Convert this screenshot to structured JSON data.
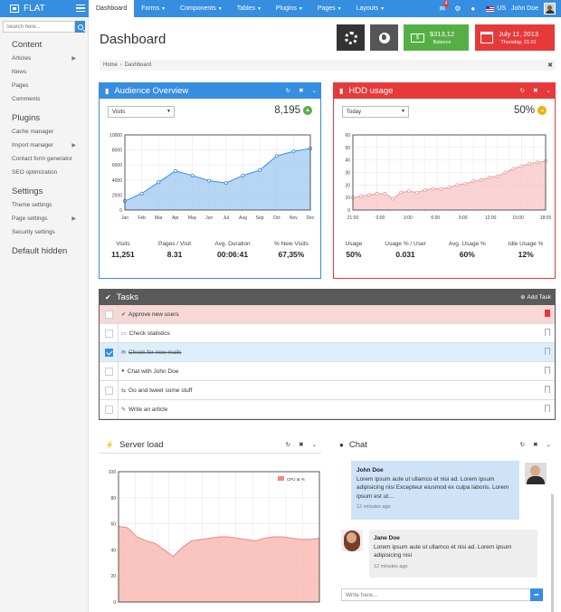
{
  "brand": {
    "name": "FLAT"
  },
  "nav": [
    {
      "label": "Dashboard",
      "caret": false,
      "active": true
    },
    {
      "label": "Forms",
      "caret": true
    },
    {
      "label": "Components",
      "caret": true
    },
    {
      "label": "Tables",
      "caret": true
    },
    {
      "label": "Plugins",
      "caret": true
    },
    {
      "label": "Pages",
      "caret": true
    },
    {
      "label": "Layouts",
      "caret": true
    }
  ],
  "topbar": {
    "mail_badge": "4",
    "lang": "US",
    "user_name": "John Doe"
  },
  "sidebar": {
    "search_placeholder": "Search here...",
    "sections": [
      {
        "title": "Content",
        "items": [
          {
            "label": "Articles",
            "arrow": true
          },
          {
            "label": "News"
          },
          {
            "label": "Pages"
          },
          {
            "label": "Comments"
          }
        ]
      },
      {
        "title": "Plugins",
        "items": [
          {
            "label": "Cache manager"
          },
          {
            "label": "Import manager",
            "arrow": true
          },
          {
            "label": "Contact form generator"
          },
          {
            "label": "SEO optimization"
          }
        ]
      },
      {
        "title": "Settings",
        "items": [
          {
            "label": "Theme settings"
          },
          {
            "label": "Page settings",
            "arrow": true
          },
          {
            "label": "Security settings"
          }
        ]
      },
      {
        "title": "Default hidden",
        "items": []
      }
    ]
  },
  "page": {
    "title": "Dashboard"
  },
  "tiles": {
    "balance_value": "$313,12",
    "balance_label": "Balance",
    "date": "July 11, 2013",
    "datetime": "Thursday, 21:01"
  },
  "breadcrumb": [
    "Home",
    "Dashboard"
  ],
  "audience": {
    "title": "Audience Overview",
    "select_value": "Visits",
    "big_value": "8,195",
    "stats": [
      {
        "label": "Visits",
        "value": "11,251"
      },
      {
        "label": "Pages / Visit",
        "value": "8.31"
      },
      {
        "label": "Avg. Duration",
        "value": "00:06:41"
      },
      {
        "label": "% New Visits",
        "value": "67,35%"
      }
    ]
  },
  "hdd": {
    "title": "HDD usage",
    "select_value": "Today",
    "big_value": "50%",
    "stats": [
      {
        "label": "Usage",
        "value": "50%"
      },
      {
        "label": "Usage % / User",
        "value": "0.031"
      },
      {
        "label": "Avg. Usage %",
        "value": "60%"
      },
      {
        "label": "Idle Usage %",
        "value": "12%"
      }
    ]
  },
  "tasks": {
    "title": "Tasks",
    "add_label": "Add Task",
    "items": [
      {
        "label": "Approve new users",
        "icon": "✔",
        "highlight": "red",
        "bookmarked": true
      },
      {
        "label": "Check statistics",
        "icon": "▭"
      },
      {
        "label": "Check for new mails",
        "icon": "✉",
        "highlight": "blue",
        "checked": true,
        "done": true
      },
      {
        "label": "Chat with John Doe",
        "icon": "●"
      },
      {
        "label": "Go and tweet some stuff",
        "icon": "⇆"
      },
      {
        "label": "Write an article",
        "icon": "✎"
      }
    ]
  },
  "server": {
    "title": "Server load"
  },
  "chat": {
    "title": "Chat",
    "messages": [
      {
        "author": "John Doe",
        "text": "Lorem ipsum aute ut ullamco et nisi ad. Lorem ipsum adipisicing nisi Excepteur eiusmod ex culpa laboris. Lorem ipsum est ut…",
        "time": "12 minutes ago"
      },
      {
        "author": "Jane Doe",
        "text": "Lorem ipsum aute ut ullamco et nisi ad. Lorem ipsum adipisicing nisi",
        "time": "12 minutes ago"
      }
    ],
    "input_placeholder": "Write here..."
  },
  "chart_data": [
    {
      "type": "area",
      "title": "Audience Overview",
      "x": [
        "Jan",
        "Feb",
        "Mar",
        "Apr",
        "May",
        "Jun",
        "Jul",
        "Aug",
        "Sep",
        "Oct",
        "Nov",
        "Dec"
      ],
      "series": [
        {
          "values": [
            1200,
            2200,
            3700,
            5200,
            4600,
            3900,
            3600,
            4600,
            5300,
            7200,
            7800,
            8200
          ]
        }
      ],
      "yticks": [
        0,
        2000,
        4000,
        6000,
        8000,
        10000
      ],
      "ylim": [
        0,
        10000
      ],
      "color": "#368ee0"
    },
    {
      "type": "area",
      "title": "HDD usage",
      "x": [
        0,
        1,
        2,
        3,
        4,
        5,
        6,
        7,
        8,
        9,
        10,
        11,
        12,
        13,
        14,
        15,
        16,
        17,
        18,
        19,
        20,
        21,
        22
      ],
      "xticks": [
        "21:00",
        "0:00",
        "3:00",
        "6:00",
        "9:00",
        "12:00",
        "15:00",
        "18:00"
      ],
      "series": [
        {
          "values": [
            10,
            11,
            12,
            13,
            13,
            9,
            14,
            15,
            14,
            16,
            17,
            17,
            18,
            20,
            21,
            23,
            24,
            26,
            27,
            30,
            33,
            35,
            37,
            38,
            39
          ]
        }
      ],
      "yticks": [
        0,
        10,
        20,
        30,
        40,
        50,
        60
      ],
      "ylim": [
        0,
        60
      ],
      "color": "#e63a3a"
    },
    {
      "type": "area",
      "title": "Server load",
      "legend": "CPU at %",
      "series": [
        {
          "name": "CPU at %",
          "values": [
            58,
            57,
            50,
            47,
            45,
            40,
            35,
            42,
            47,
            48,
            49,
            50,
            50,
            49,
            48,
            47,
            49,
            50,
            50,
            49,
            48,
            48,
            49
          ]
        }
      ],
      "yticks": [
        0,
        20,
        40,
        60,
        80,
        100
      ],
      "ylim": [
        0,
        100
      ],
      "color": "#e63a3a"
    }
  ]
}
